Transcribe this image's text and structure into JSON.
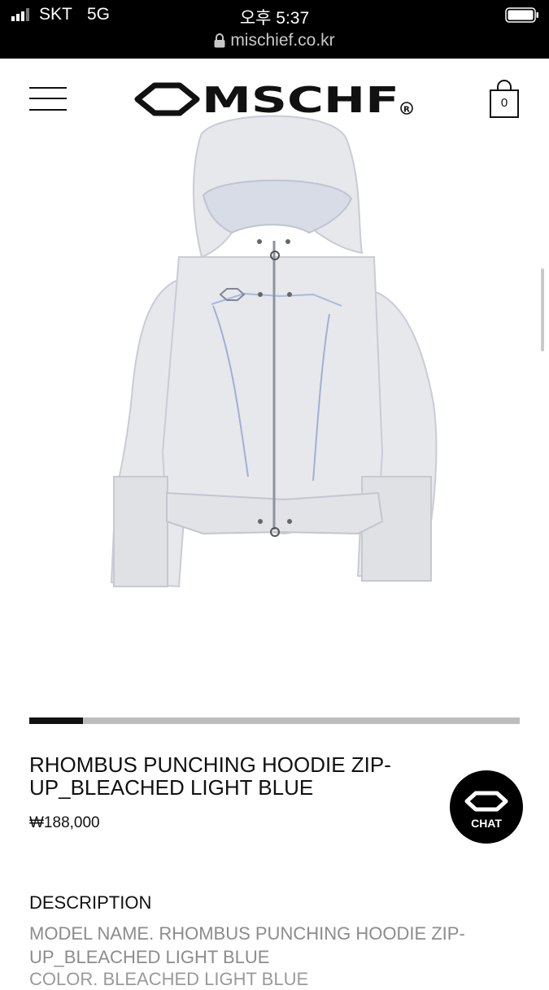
{
  "status_bar": {
    "carrier": "SKT",
    "network": "5G",
    "time": "오후 5:37"
  },
  "browser": {
    "url": "mischief.co.kr"
  },
  "header": {
    "brand": "MSCHF",
    "registered_mark": "R",
    "cart_count": "0"
  },
  "product": {
    "title": "RHOMBUS PUNCHING HOODIE ZIP-UP_BLEACHED LIGHT BLUE",
    "price": "₩188,000",
    "gallery_position": 0.11
  },
  "chat": {
    "label": "CHAT"
  },
  "description": {
    "heading": "DESCRIPTION",
    "model_name": "MODEL NAME. RHOMBUS PUNCHING HOODIE ZIP-UP_BLEACHED LIGHT BLUE",
    "next_line_partial": "COLOR. BLEACHED LIGHT BLUE"
  },
  "colors": {
    "header_bg": "#000000",
    "accent": "#111111",
    "muted_text": "#8c8c8c"
  },
  "icons": [
    "signal-icon",
    "battery-icon",
    "lock-icon",
    "hamburger-icon",
    "brand-logo-icon",
    "shopping-bag-icon",
    "chat-icon"
  ]
}
